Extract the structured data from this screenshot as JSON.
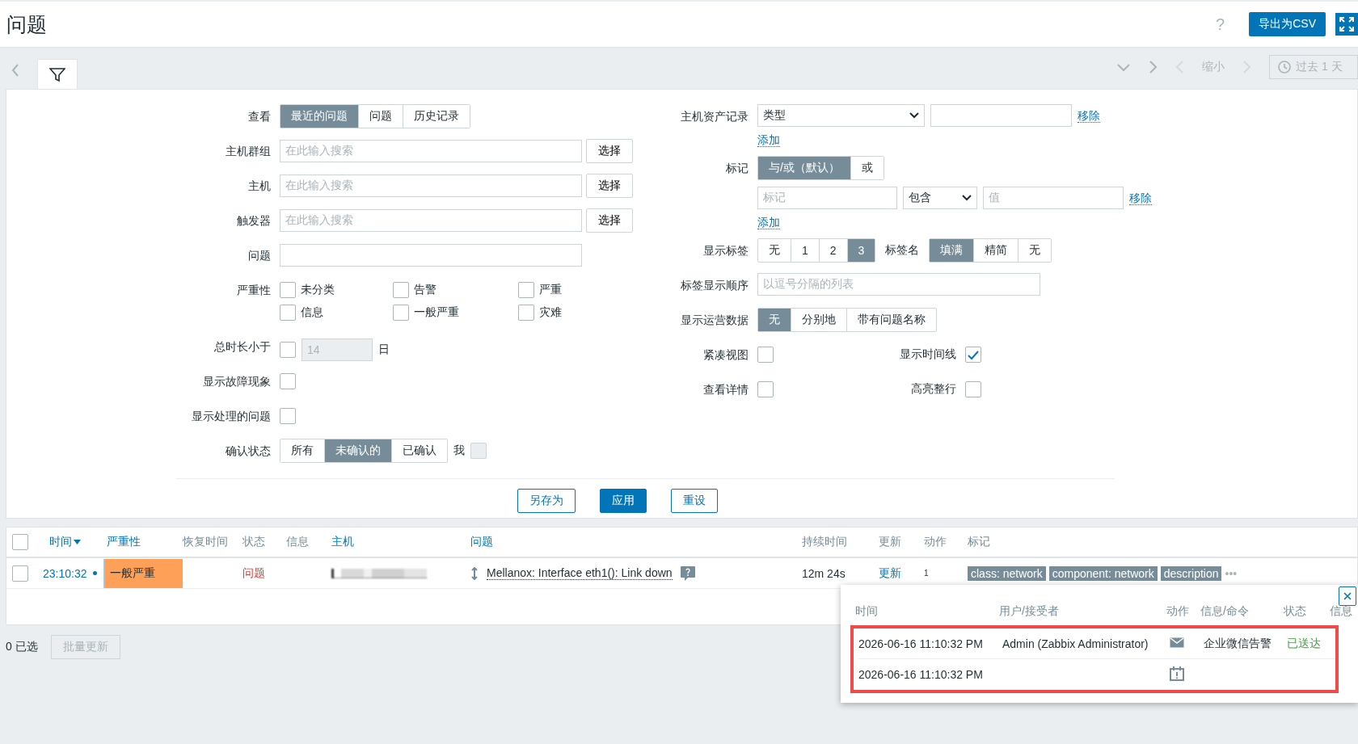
{
  "header": {
    "title": "问题",
    "help": "?",
    "export_button": "导出为CSV"
  },
  "filter_bar": {
    "tabs": [
      {
        "kind": "filter",
        "selected": true
      }
    ],
    "zoom_out": "缩小",
    "time_range": "过去 1 天"
  },
  "filter": {
    "left": [
      {
        "kind": "segmented",
        "label": "查看",
        "options": [
          {
            "label": "最近的问题",
            "selected": true
          },
          {
            "label": "问题",
            "selected": false
          },
          {
            "label": "历史记录",
            "selected": false
          }
        ]
      },
      {
        "kind": "multiselect",
        "label": "主机群组",
        "placeholder": "在此输入搜索",
        "button": "选择"
      },
      {
        "kind": "multiselect",
        "label": "主机",
        "placeholder": "在此输入搜索",
        "button": "选择"
      },
      {
        "kind": "multiselect",
        "label": "触发器",
        "placeholder": "在此输入搜索",
        "button": "选择"
      },
      {
        "kind": "text",
        "label": "问题"
      },
      {
        "kind": "checks",
        "label": "严重性",
        "options": [
          {
            "label": "未分类",
            "checked": false
          },
          {
            "label": "告警",
            "checked": false
          },
          {
            "label": "严重",
            "checked": false
          },
          {
            "label": "信息",
            "checked": false
          },
          {
            "label": "一般严重",
            "checked": false
          },
          {
            "label": "灾难",
            "checked": false
          }
        ]
      },
      {
        "kind": "age",
        "label": "总时长小于",
        "checked": false,
        "value": "14",
        "unit": "日"
      },
      {
        "kind": "checkbox",
        "label": "显示故障现象",
        "checked": false
      },
      {
        "kind": "checkbox",
        "label": "显示处理的问题",
        "checked": false
      },
      {
        "kind": "ack",
        "label": "确认状态",
        "options": [
          {
            "label": "所有",
            "selected": false
          },
          {
            "label": "未确认的",
            "selected": true
          },
          {
            "label": "已确认",
            "selected": false
          }
        ],
        "me_label": "我",
        "me_checked": false
      }
    ],
    "right": [
      {
        "kind": "inventory",
        "label": "主机资产记录",
        "select": "类型",
        "remove": "移除",
        "add": "添加"
      },
      {
        "kind": "tags",
        "label": "标记",
        "options": [
          {
            "label": "与/或（默认）",
            "selected": true
          },
          {
            "label": "或",
            "selected": false
          }
        ],
        "tag_placeholder": "标记",
        "operator": "包含",
        "value_placeholder": "值",
        "remove": "移除",
        "add": "添加"
      },
      {
        "kind": "showtags",
        "label": "显示标签",
        "options": [
          {
            "label": "无",
            "selected": false
          },
          {
            "label": "1",
            "selected": false
          },
          {
            "label": "2",
            "selected": false
          },
          {
            "label": "3",
            "selected": true
          }
        ],
        "label2": "标签名",
        "options2": [
          {
            "label": "填满",
            "selected": true
          },
          {
            "label": "精简",
            "selected": false
          },
          {
            "label": "无",
            "selected": false
          }
        ]
      },
      {
        "kind": "textph",
        "label": "标签显示顺序",
        "placeholder": "以逗号分隔的列表"
      },
      {
        "kind": "segmented",
        "label": "显示运营数据",
        "options": [
          {
            "label": "无",
            "selected": true
          },
          {
            "label": "分别地",
            "selected": false
          },
          {
            "label": "带有问题名称",
            "selected": false
          }
        ]
      },
      {
        "kind": "checkpair",
        "label": "紧凑视图",
        "checked": false,
        "label2": "显示时间线",
        "checked2": true
      },
      {
        "kind": "checkpair",
        "label": "查看详情",
        "checked": false,
        "label2": "高亮整行",
        "checked2": false
      }
    ],
    "buttons": [
      {
        "label": "另存为",
        "primary": false
      },
      {
        "label": "应用",
        "primary": true
      },
      {
        "label": "重设",
        "primary": false
      }
    ]
  },
  "table": {
    "select_all": {
      "checked": false
    },
    "columns": [
      {
        "label": "时间",
        "link": true,
        "sorted": true
      },
      {
        "label": "严重性",
        "link": true,
        "sorted": false
      },
      {
        "label": "恢复时间",
        "link": false,
        "sorted": false
      },
      {
        "label": "状态",
        "link": false,
        "sorted": false
      },
      {
        "label": "信息",
        "link": false,
        "sorted": false
      },
      {
        "label": "主机",
        "link": true,
        "sorted": false
      },
      {
        "label": "问题",
        "link": true,
        "sorted": false
      },
      {
        "label": "持续时间",
        "link": false,
        "sorted": false
      },
      {
        "label": "更新",
        "link": false,
        "sorted": false
      },
      {
        "label": "动作",
        "link": false,
        "sorted": false
      },
      {
        "label": "标记",
        "link": false,
        "sorted": false
      }
    ],
    "rows": [
      {
        "checked": false,
        "time": "23:10:32",
        "severity": "一般严重",
        "color": "#ffa059",
        "status": "问题",
        "problem": "Mellanox: Interface eth1(): Link down",
        "duration": "12m 24s",
        "update": "更新",
        "actions": "1",
        "tags": [
          "class: network",
          "component: network",
          "description"
        ],
        "more": "•••"
      }
    ]
  },
  "footer": {
    "selected": "0 已选",
    "mass_update": "批量更新"
  },
  "popup": {
    "columns": [
      "时间",
      "用户/接受者",
      "动作",
      "信息/命令",
      "状态",
      "信息"
    ],
    "highlighted": true,
    "rows": [
      {
        "time": "2026-06-16 11:10:32 PM",
        "user": "Admin (Zabbix Administrator)",
        "kind": "mail",
        "message": "企业微信告警",
        "status": "已送达"
      },
      {
        "time": "2026-06-16 11:10:32 PM",
        "kind": "event"
      }
    ]
  }
}
